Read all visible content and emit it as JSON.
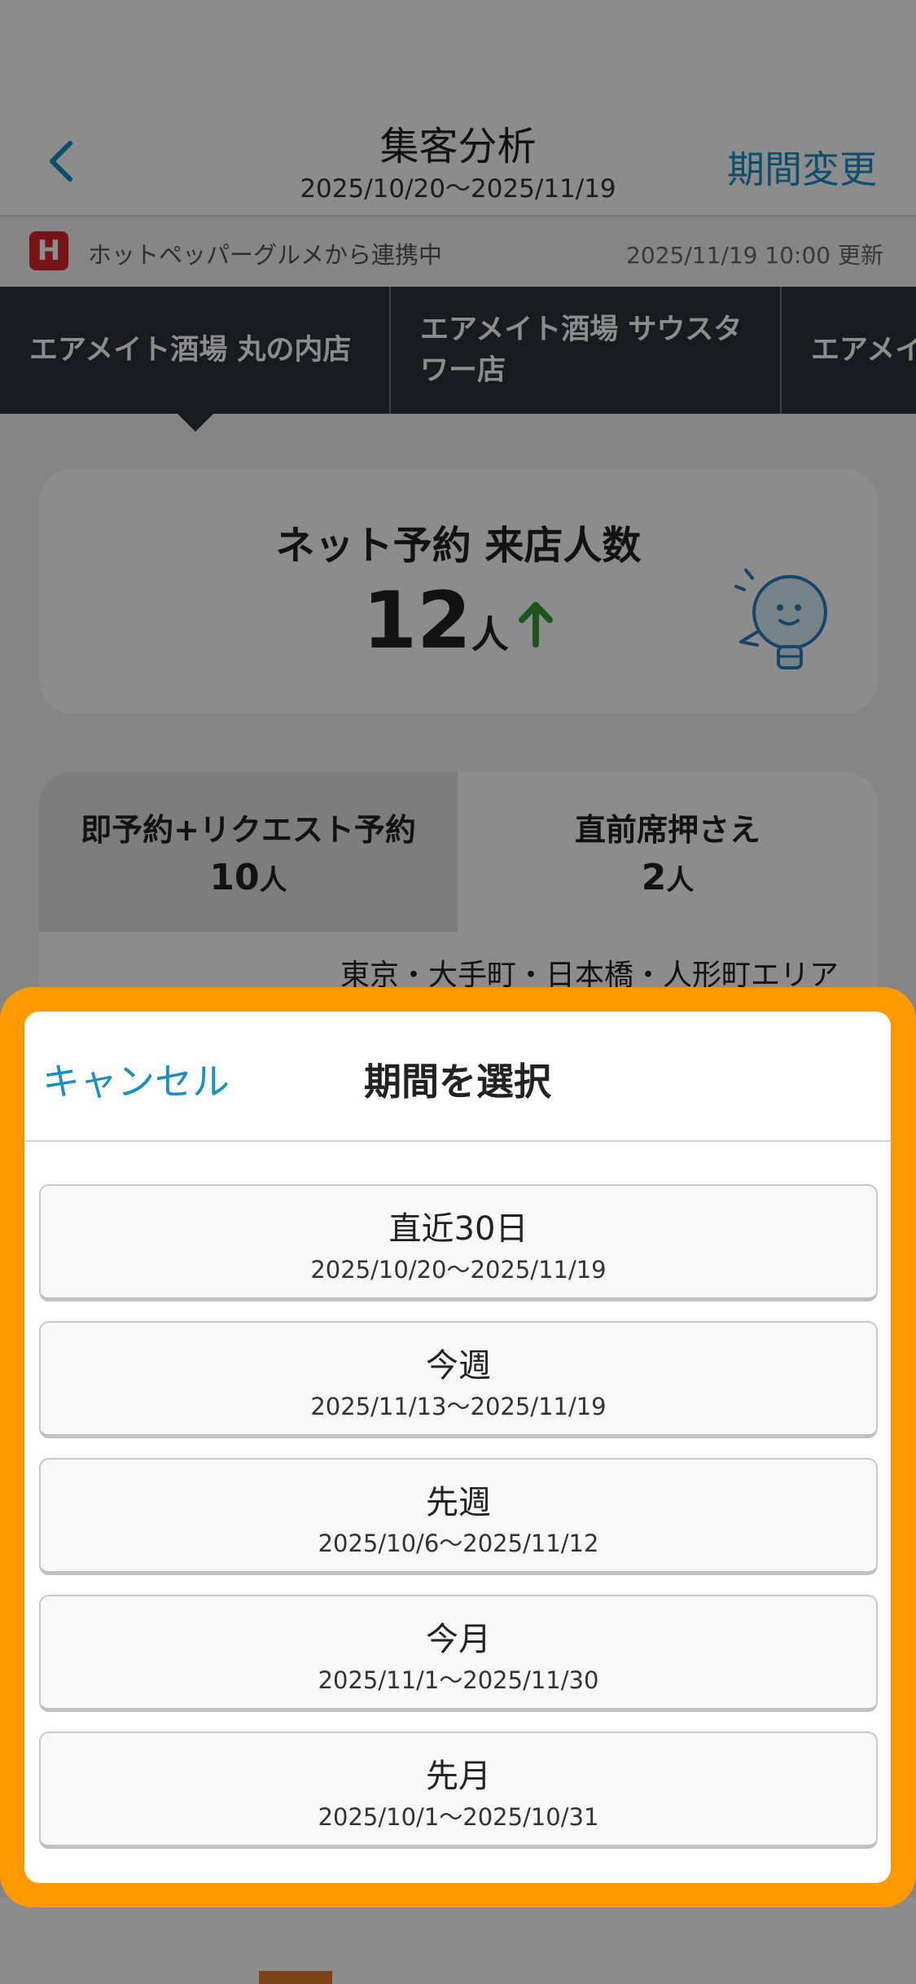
{
  "header": {
    "title": "集客分析",
    "date_range": "2025/10/20〜2025/11/19",
    "period_change": "期間変更"
  },
  "sync_bar": {
    "icon_text": "H",
    "source_text": "ホットペッパーグルメから連携中",
    "updated_text": "2025/11/19 10:00 更新"
  },
  "store_tabs": [
    "エアメイト酒場 丸の内店",
    "エアメイト酒場 サウスタワー店",
    "エアメイト"
  ],
  "summary": {
    "label": "ネット予約 来店人数",
    "value": "12",
    "unit": "人",
    "trend": "up",
    "trend_color": "#3a9a3a"
  },
  "breakdown": {
    "left": {
      "label": "即予約+リクエスト予約",
      "value": "10",
      "unit": "人"
    },
    "right": {
      "label": "直前席押さえ",
      "value": "2",
      "unit": "人"
    },
    "area": "東京・大手町・日本橋・人形町エリア"
  },
  "modal": {
    "cancel_label": "キャンセル",
    "title": "期間を選択",
    "frame_color": "#ff9900",
    "options": [
      {
        "label": "直近30日",
        "range": "2025/10/20〜2025/11/19"
      },
      {
        "label": "今週",
        "range": "2025/11/13〜2025/11/19"
      },
      {
        "label": "先週",
        "range": "2025/10/6〜2025/11/12"
      },
      {
        "label": "今月",
        "range": "2025/11/1〜2025/11/30"
      },
      {
        "label": "先月",
        "range": "2025/10/1〜2025/10/31"
      }
    ]
  },
  "colors": {
    "accent": "#1a8fc6",
    "tab_bar": "#2b313a"
  }
}
